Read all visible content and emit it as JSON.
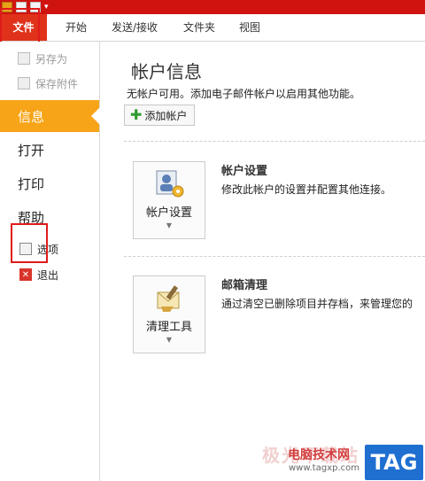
{
  "colors": {
    "titlebar": "#cf1410",
    "file_tab": "#e0321b",
    "active": "#f7a418",
    "highlight_box": "#e01b1b",
    "tag": "#1f6fd1"
  },
  "ribbon": {
    "tabs": [
      "文件",
      "开始",
      "发送/接收",
      "文件夹",
      "视图"
    ]
  },
  "sidebar": {
    "save_as": "另存为",
    "save_attachments": "保存附件",
    "info": "信息",
    "open": "打开",
    "print": "打印",
    "help": "帮助",
    "options": "选项",
    "exit": "退出"
  },
  "main": {
    "title": "帐户信息",
    "subtitle": "无帐户可用。添加电子邮件帐户以启用其他功能。",
    "add_account": "添加帐户",
    "account_settings": {
      "button_label": "帐户设置",
      "title": "帐户设置",
      "desc": "修改此帐户的设置并配置其他连接。"
    },
    "cleanup": {
      "button_label": "清理工具",
      "title": "邮箱清理",
      "desc": "通过清空已删除项目并存档，来管理您的"
    }
  },
  "watermark": {
    "text": "极光下载站",
    "site": "电脑技术网",
    "url": "www.tagxp.com",
    "tag": "TAG"
  }
}
